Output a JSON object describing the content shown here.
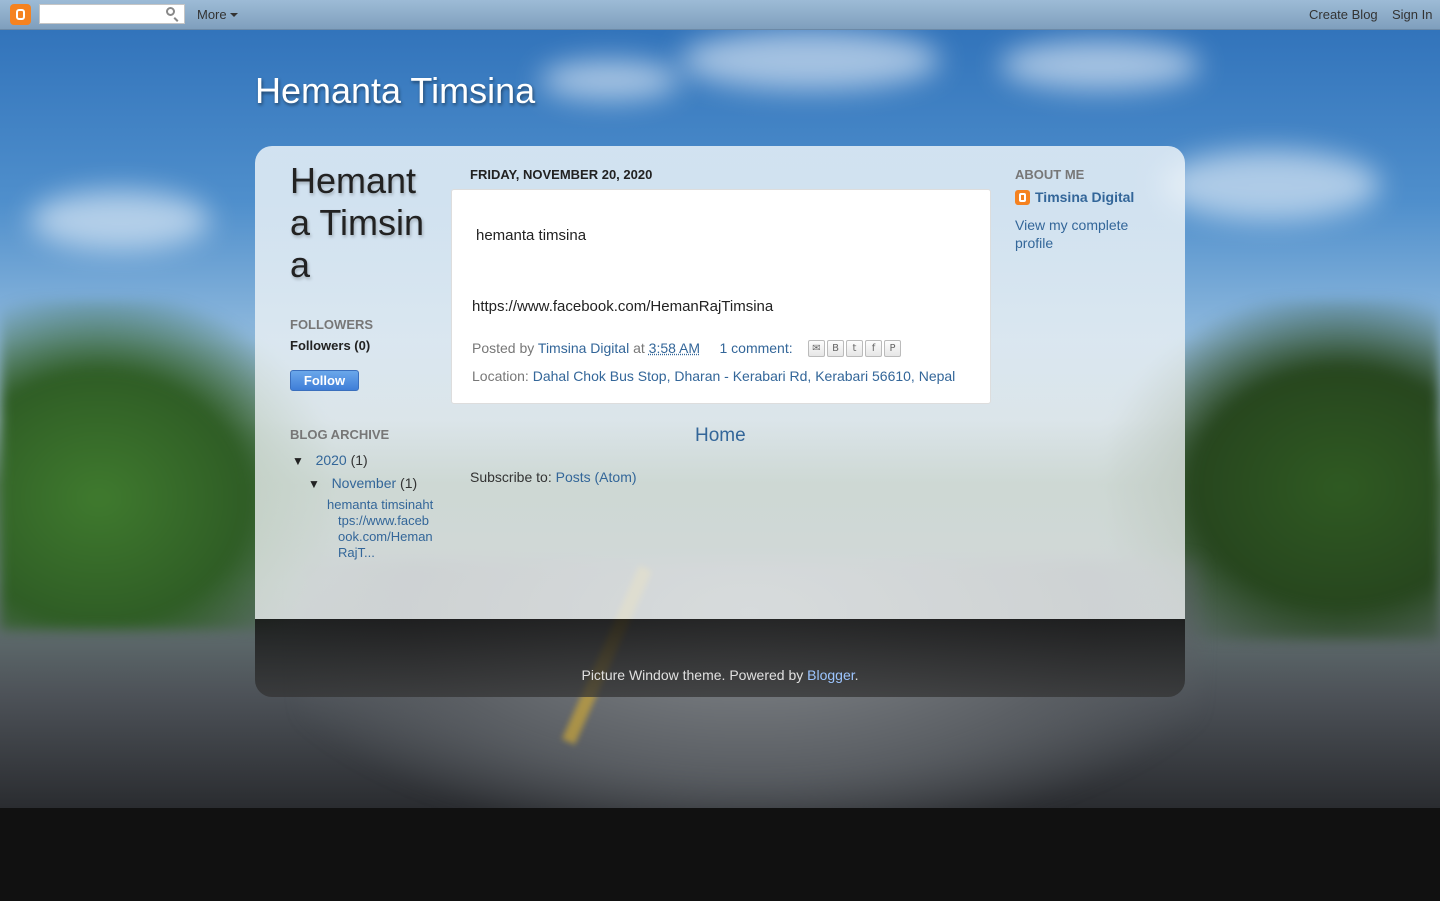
{
  "navbar": {
    "search_value": "",
    "more_label": "More",
    "create_blog_label": "Create Blog",
    "sign_in_label": "Sign In"
  },
  "header": {
    "title": "Hemanta Timsina"
  },
  "left_sidebar": {
    "title": "Hemanta Timsina",
    "followers_heading": "Followers",
    "followers_count": "Followers (0)",
    "follow_button": "Follow",
    "archive_heading": "Blog Archive",
    "archive": {
      "year_toggle": "▼",
      "year": "2020",
      "year_count": "(1)",
      "month_toggle": "▼",
      "month": "November",
      "month_count": "(1)",
      "post_title": "hemanta timsinahttps://www.facebook.com/HemanRajT..."
    }
  },
  "post": {
    "date": "Friday, November 20, 2020",
    "body_line1": "hemanta timsina",
    "body_line2": "https://www.facebook.com/HemanRajTimsina",
    "posted_by_label": "Posted by",
    "author": "Timsina Digital",
    "at_label": "at",
    "time": "3:58 AM",
    "comments": "1 comment:",
    "location_label": "Location:",
    "location": "Dahal Chok Bus Stop, Dharan - Kerabari Rd, Kerabari 56610, Nepal",
    "share_icons": [
      "email-icon",
      "blogger-icon",
      "twitter-icon",
      "facebook-icon",
      "pinterest-icon"
    ]
  },
  "main": {
    "home_link": "Home",
    "subscribe_label": "Subscribe to:",
    "subscribe_link": "Posts (Atom)"
  },
  "right_sidebar": {
    "about_heading": "About Me",
    "profile_name": "Timsina Digital",
    "view_profile": "View my complete profile"
  },
  "footer": {
    "text": "Picture Window theme. Powered by",
    "link": "Blogger",
    "period": "."
  },
  "colors": {
    "link": "#336699",
    "blogger_orange": "#f58220",
    "follow_button": "#3f7ed8"
  }
}
